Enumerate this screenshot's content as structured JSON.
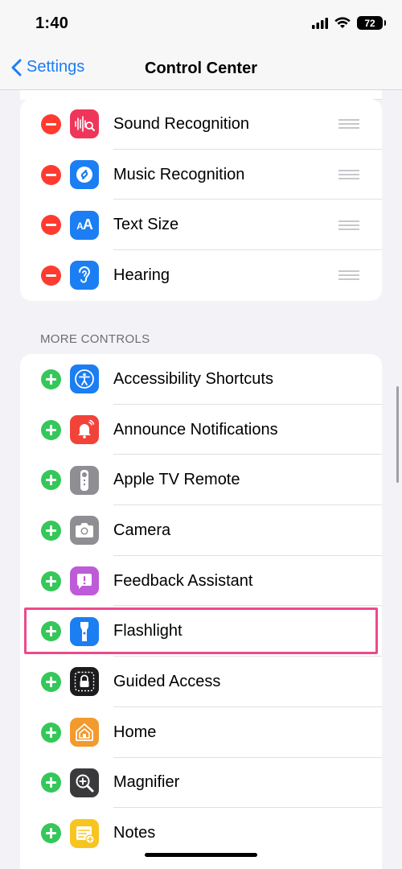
{
  "status_bar": {
    "time": "1:40",
    "battery": "72"
  },
  "nav": {
    "back_label": "Settings",
    "title": "Control Center"
  },
  "included_controls": [
    {
      "label": "Sound Recognition",
      "icon": "sound-recognition-icon",
      "color": "#f0355a"
    },
    {
      "label": "Music Recognition",
      "icon": "shazam-icon",
      "color": "#1b7ef2"
    },
    {
      "label": "Text Size",
      "icon": "text-size-icon",
      "color": "#1b7ef2",
      "glyph": "AA"
    },
    {
      "label": "Hearing",
      "icon": "ear-icon",
      "color": "#1b7ef2"
    }
  ],
  "more_controls_header": "MORE CONTROLS",
  "more_controls": [
    {
      "label": "Accessibility Shortcuts",
      "icon": "accessibility-icon",
      "color": "#1b7ef2"
    },
    {
      "label": "Announce Notifications",
      "icon": "announce-notifications-icon",
      "color": "#f2433a"
    },
    {
      "label": "Apple TV Remote",
      "icon": "tv-remote-icon",
      "color": "#8e8e93"
    },
    {
      "label": "Camera",
      "icon": "camera-icon",
      "color": "#8e8e93"
    },
    {
      "label": "Feedback Assistant",
      "icon": "feedback-icon",
      "color": "#bd5bd8"
    },
    {
      "label": "Flashlight",
      "icon": "flashlight-icon",
      "color": "#1b7ef2"
    },
    {
      "label": "Guided Access",
      "icon": "lock-icon",
      "color": "#1c1c1e"
    },
    {
      "label": "Home",
      "icon": "home-icon",
      "color": "#f29a2e"
    },
    {
      "label": "Magnifier",
      "icon": "magnifier-icon",
      "color": "#3a3a3c"
    },
    {
      "label": "Notes",
      "icon": "notes-icon",
      "color": "#f7c51f"
    }
  ],
  "colors": {
    "accent": "#1a7cf5",
    "remove": "#ff3b30",
    "add": "#34c759",
    "highlight": "#ec4a8b"
  }
}
